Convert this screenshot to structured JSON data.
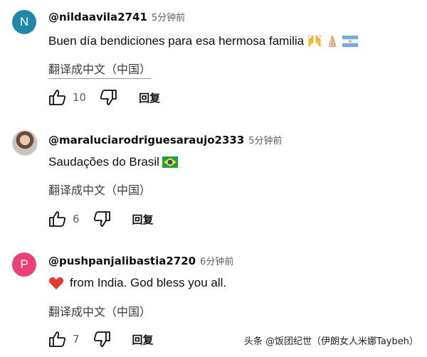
{
  "comments": [
    {
      "avatar_letter": "N",
      "avatar_color": "#1e88a8",
      "author": "@nildaavila2741",
      "time": "5分钟前",
      "text": "Buen día bendiciones para  esa hermosa familia",
      "emojis": [
        "raising-hands-emoji",
        "praying-hands-emoji",
        "argentina-flag-emoji"
      ],
      "translate": "翻译成中文（中国）",
      "likes": "10",
      "reply": "回复"
    },
    {
      "avatar_letter": "",
      "avatar_color": "#c9c2bd",
      "author": "@maraluciarodriguesaraujo2333",
      "time": "5分钟前",
      "text": "Saudações do Brasil",
      "emojis": [
        "brazil-flag-emoji"
      ],
      "translate": "翻译成中文（中国）",
      "likes": "6",
      "reply": "回复"
    },
    {
      "avatar_letter": "P",
      "avatar_color": "#ec407a",
      "author": "@pushpanjalibastia2720",
      "time": "6分钟前",
      "text": "from India. God bless you all.",
      "emojis": [
        "red-heart-emoji"
      ],
      "translate": "翻译成中文（中国）",
      "likes": "7",
      "reply": "回复"
    }
  ],
  "watermark": "头条 @饭团纪世（伊朗女人米娜Taybeh）"
}
